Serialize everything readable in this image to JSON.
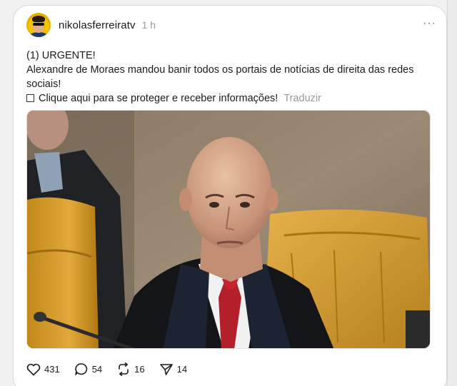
{
  "post": {
    "username": "nikolasferreiratv",
    "timestamp": "1 h",
    "more_label": "···",
    "lines": [
      "(1) URGENTE!",
      "Alexandre de Moraes mandou banir todos os portais de notícias de direita das redes",
      "sociais!"
    ],
    "cta_text": "Clique aqui para se proteger e receber informações!",
    "translate_label": "Traduzir",
    "image_icon": "photo-of-man-in-judicial-robe"
  },
  "actions": {
    "likes": "431",
    "comments": "54",
    "reposts": "16",
    "shares": "14"
  },
  "colors": {
    "card_bg": "#ffffff",
    "muted_text": "#9a9a9a",
    "text": "#1b1b1b"
  }
}
